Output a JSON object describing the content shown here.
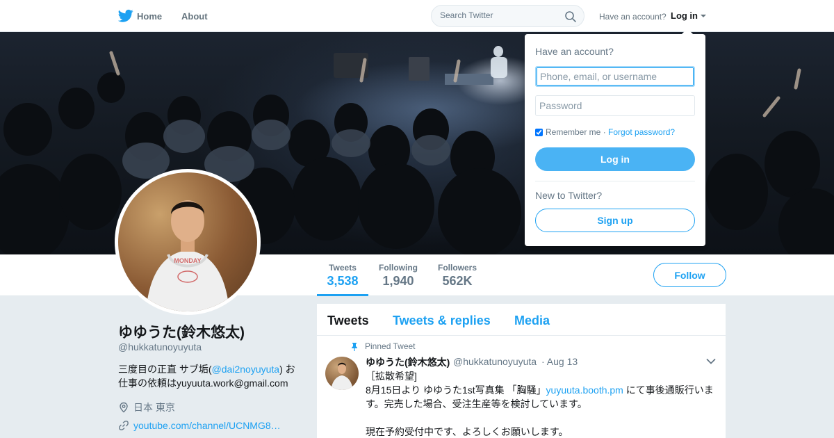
{
  "nav": {
    "home": "Home",
    "about": "About",
    "search_placeholder": "Search Twitter",
    "have_account": "Have an account?",
    "login": "Log in",
    "icons": [
      "twitter-bird-icon",
      "search-icon",
      "caret-down-icon"
    ]
  },
  "colors": {
    "accent": "#1da1f2",
    "login_button": "#4ab3f4",
    "background": "#e6ecf0"
  },
  "profile": {
    "name": "ゆゆうた(鈴木悠太)",
    "handle": "@hukkatunoyuyuta",
    "bio_prefix": "三度目の正直 サブ垢(",
    "bio_link": "@dai2noyuyuta",
    "bio_suffix": ") お仕事の依頼はyuyuuta.work@gmail.com",
    "location": "日本 東京",
    "website": "youtube.com/channel/UCNMG8…"
  },
  "stats": [
    {
      "label": "Tweets",
      "value": "3,538"
    },
    {
      "label": "Following",
      "value": "1,940"
    },
    {
      "label": "Followers",
      "value": "562K"
    }
  ],
  "follow_label": "Follow",
  "timeline": {
    "tabs": [
      "Tweets",
      "Tweets & replies",
      "Media"
    ],
    "tweet": {
      "pinned_label": "Pinned Tweet",
      "name": "ゆゆうた(鈴木悠太)",
      "handle": "@hukkatunoyuyuta",
      "date": "· Aug 13",
      "line1": "［拡散希望]",
      "line2_prefix": "8月15日より ゆゆうた1st写真集 「胸騒」",
      "line2_link": "yuyuuta.booth.pm",
      "line2_suffix": " にて事後通販行います。完売した場合、受注生産等を検討しています。",
      "line3": "現在予約受付中です、よろしくお願いします。"
    }
  },
  "login_dropdown": {
    "title": "Have an account?",
    "username_placeholder": "Phone, email, or username",
    "password_placeholder": "Password",
    "remember": "Remember me",
    "separator": " · ",
    "forgot": "Forgot password?",
    "login_button": "Log in",
    "new_prompt": "New to Twitter?",
    "signup_button": "Sign up"
  }
}
